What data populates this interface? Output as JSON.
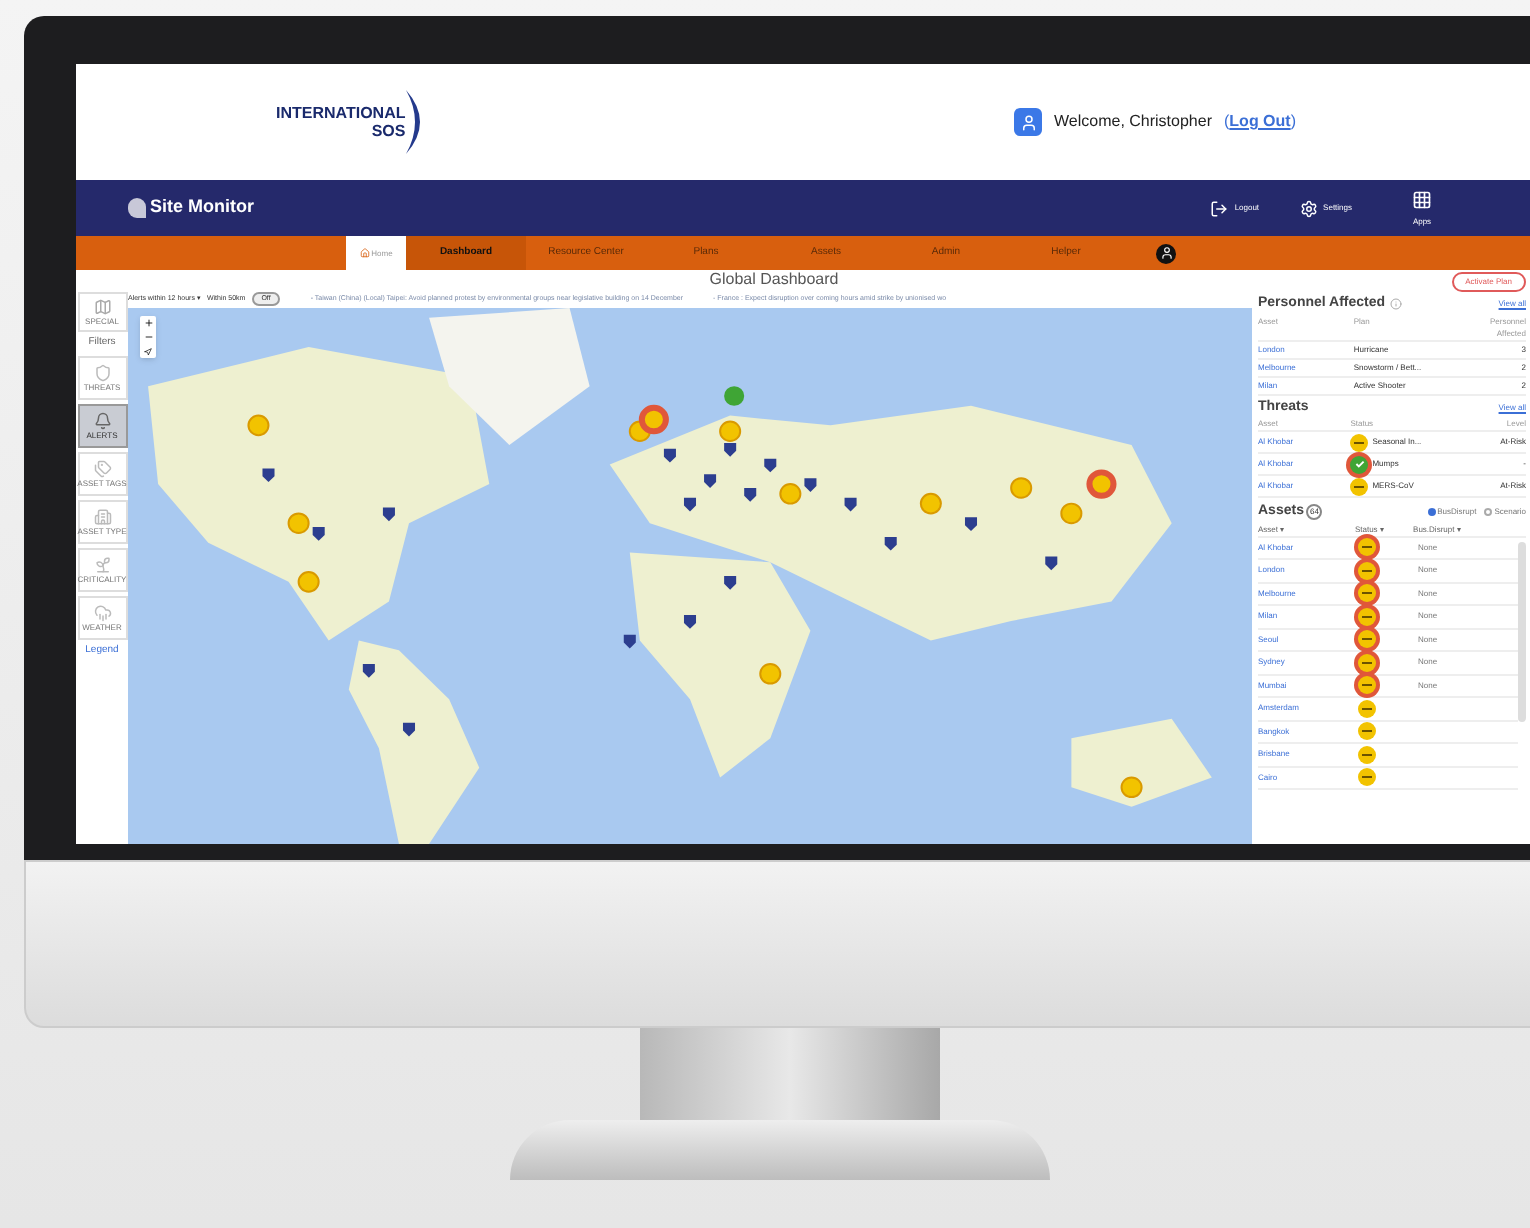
{
  "header": {
    "logo": {
      "line1": "INTERNATIONAL",
      "line2": "SOS"
    },
    "welcome": "Welcome, Christopher",
    "open_paren": "(",
    "logout_link": "Log Out",
    "close_paren": ")"
  },
  "app_bar": {
    "title": "Site Monitor",
    "actions": [
      {
        "kind": "logout",
        "label": "Logout"
      },
      {
        "kind": "settings",
        "label": "Settings"
      },
      {
        "kind": "apps",
        "label": "Apps"
      }
    ]
  },
  "home_button": "Home",
  "nav": [
    {
      "label": "Dashboard",
      "selected": true
    },
    {
      "label": "Resource Center",
      "selected": false
    },
    {
      "label": "Plans",
      "selected": false
    },
    {
      "label": "Assets",
      "selected": false
    },
    {
      "label": "Admin",
      "selected": false
    },
    {
      "label": "Helper",
      "selected": false
    }
  ],
  "page_title": "Global Dashboard",
  "alerts_bar": {
    "filter": "Alerts within 12 hours ▾",
    "radius": "Within 50km",
    "toggle": {
      "label": "Off",
      "on": false
    },
    "ticker": [
      "- Taiwan (China) (Local) Taipei: Avoid planned protest by environmental groups near legislative building on 14 December",
      "- France : Expect disruption over coming hours amid strike by unionised wo"
    ]
  },
  "activate_button": "Activate Plan",
  "sidebar": {
    "top": {
      "label": "SPECIAL"
    },
    "filters_heading": "Filters",
    "filters": [
      {
        "kind": "threats",
        "label": "THREATS",
        "selected": false
      },
      {
        "kind": "alerts",
        "label": "ALERTS",
        "selected": true
      },
      {
        "kind": "tags",
        "label": "ASSET TAGS",
        "selected": false
      },
      {
        "kind": "type",
        "label": "ASSET TYPE",
        "selected": false
      },
      {
        "kind": "criticality",
        "label": "CRITICALITY",
        "selected": false
      },
      {
        "kind": "weather",
        "label": "WEATHER",
        "selected": false
      }
    ],
    "legend": "Legend"
  },
  "personnel_affected": {
    "title": "Personnel Affected",
    "view_all": "View all",
    "columns": [
      "Asset",
      "Plan",
      "Personnel Affected"
    ],
    "rows": [
      {
        "asset": "London",
        "plan": "Hurricane",
        "count": "3"
      },
      {
        "asset": "Melbourne",
        "plan": "Snowstorm / Bett...",
        "count": "2"
      },
      {
        "asset": "Milan",
        "plan": "Active Shooter",
        "count": "2"
      }
    ]
  },
  "threats": {
    "title": "Threats",
    "view_all": "View all",
    "columns": [
      "Asset",
      "Status",
      "Level"
    ],
    "rows": [
      {
        "asset": "Al Khobar",
        "cleared": false,
        "ring": false,
        "name": "Seasonal In...",
        "level": "At-Risk"
      },
      {
        "asset": "Al Khobar",
        "cleared": true,
        "ring": true,
        "name": "Mumps",
        "level": "-"
      },
      {
        "asset": "Al Khobar",
        "cleared": false,
        "ring": false,
        "name": "MERS-CoV",
        "level": "At-Risk"
      }
    ]
  },
  "assets": {
    "title": "Assets",
    "count": "64",
    "options": [
      {
        "label": "BusDisrupt",
        "selected": true
      },
      {
        "label": "Scenario",
        "selected": false
      }
    ],
    "columns": [
      "Asset ▾",
      "Status ▾",
      "Bus.Disrupt ▾"
    ],
    "rows": [
      {
        "asset": "Al Khobar",
        "cleared": false,
        "ring": true,
        "disrupt": "None"
      },
      {
        "asset": "London",
        "cleared": false,
        "ring": true,
        "disrupt": "None"
      },
      {
        "asset": "Melbourne",
        "cleared": false,
        "ring": true,
        "disrupt": "None"
      },
      {
        "asset": "Milan",
        "cleared": false,
        "ring": true,
        "disrupt": "None"
      },
      {
        "asset": "Seoul",
        "cleared": false,
        "ring": true,
        "disrupt": "None"
      },
      {
        "asset": "Sydney",
        "cleared": false,
        "ring": true,
        "disrupt": "None"
      },
      {
        "asset": "Mumbai",
        "cleared": false,
        "ring": true,
        "disrupt": "None"
      },
      {
        "asset": "Amsterdam",
        "cleared": false,
        "ring": false
      },
      {
        "asset": "Bangkok",
        "cleared": false,
        "ring": false
      },
      {
        "asset": "Brisbane",
        "cleared": false,
        "ring": false
      },
      {
        "asset": "Cairo",
        "cleared": false,
        "ring": false
      }
    ]
  }
}
